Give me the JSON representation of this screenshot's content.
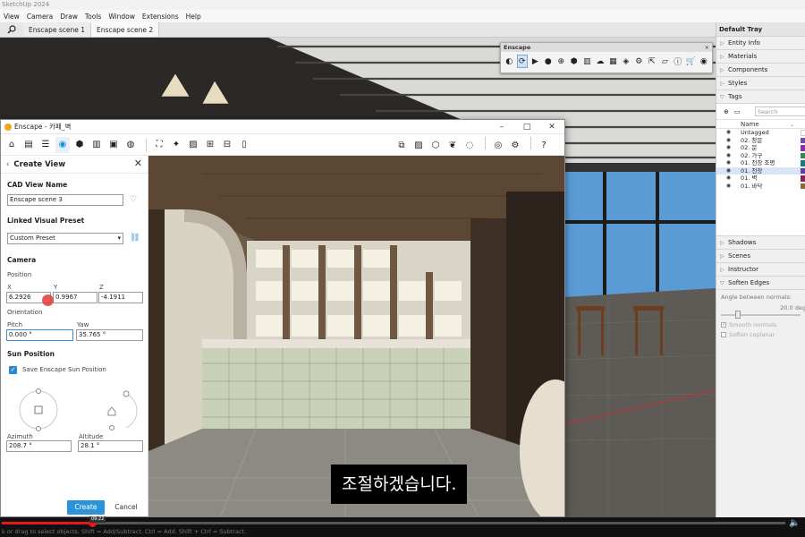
{
  "app": {
    "title": "SketchUp 2024",
    "menu": [
      "View",
      "Camera",
      "Draw",
      "Tools",
      "Window",
      "Extensions",
      "Help"
    ],
    "scene_tabs": [
      "Enscape scene 1",
      "Enscape scene 2"
    ],
    "active_scene_tab": 1
  },
  "tray": {
    "title": "Default Tray",
    "panels_collapsed_top": [
      "Entity Info",
      "Materials",
      "Components",
      "Styles"
    ],
    "tags": {
      "label": "Tags",
      "search_placeholder": "Search",
      "column_name": "Name",
      "items": [
        {
          "name": "Untagged",
          "color": "#ffffff"
        },
        {
          "name": "02. 창문",
          "color": "#6e4ea8"
        },
        {
          "name": "02. 문",
          "color": "#8a2fb0"
        },
        {
          "name": "02. 가구",
          "color": "#2f8a54"
        },
        {
          "name": "01. 천장 조명",
          "color": "#1a7a7a"
        },
        {
          "name": "01. 천장",
          "color": "#5a3fa6",
          "selected": true
        },
        {
          "name": "01. 벽",
          "color": "#8c1f5a"
        },
        {
          "name": "01. 바닥",
          "color": "#8a6a2f"
        }
      ]
    },
    "panels_collapsed_bottom": [
      "Shadows",
      "Scenes",
      "Instructor"
    ],
    "soften": {
      "label": "Soften Edges",
      "angle_label": "Angle between normals:",
      "angle_value": "20.0",
      "angle_unit": "deg",
      "smooth_normals": "Smooth normals",
      "soften_coplanar": "Soften coplanar"
    }
  },
  "enscape_toolbar": {
    "title": "Enscape",
    "close": "×"
  },
  "enscape_window": {
    "title": "Enscape - 카페_벽",
    "panel": {
      "title": "Create View",
      "cad_view_name_label": "CAD View Name",
      "cad_view_name_value": "Enscape scene 3",
      "linked_preset_label": "Linked Visual Preset",
      "linked_preset_value": "Custom Preset",
      "camera_label": "Camera",
      "position_label": "Position",
      "x_label": "X",
      "x_value": "6.2926",
      "y_label": "Y",
      "y_value": "0.9967",
      "z_label": "Z",
      "z_value": "-4.1911",
      "orientation_label": "Orientation",
      "pitch_label": "Pitch",
      "pitch_value": "0.000 °",
      "yaw_label": "Yaw",
      "yaw_value": "35.765 °",
      "sun_label": "Sun Position",
      "save_sun_label": "Save Enscape Sun Position",
      "azimuth_label": "Azimuth",
      "azimuth_value": "208.7 °",
      "altitude_label": "Altitude",
      "altitude_value": "28.1 °",
      "create_label": "Create",
      "cancel_label": "Cancel"
    }
  },
  "subtitle": "조절하겠습니다.",
  "video": {
    "progress": 0.115,
    "tooltip": "09:22"
  },
  "status_bar": "k or drag to select objects. Shift = Add/Subtract. Ctrl = Add. Shift + Ctrl = Subtract."
}
